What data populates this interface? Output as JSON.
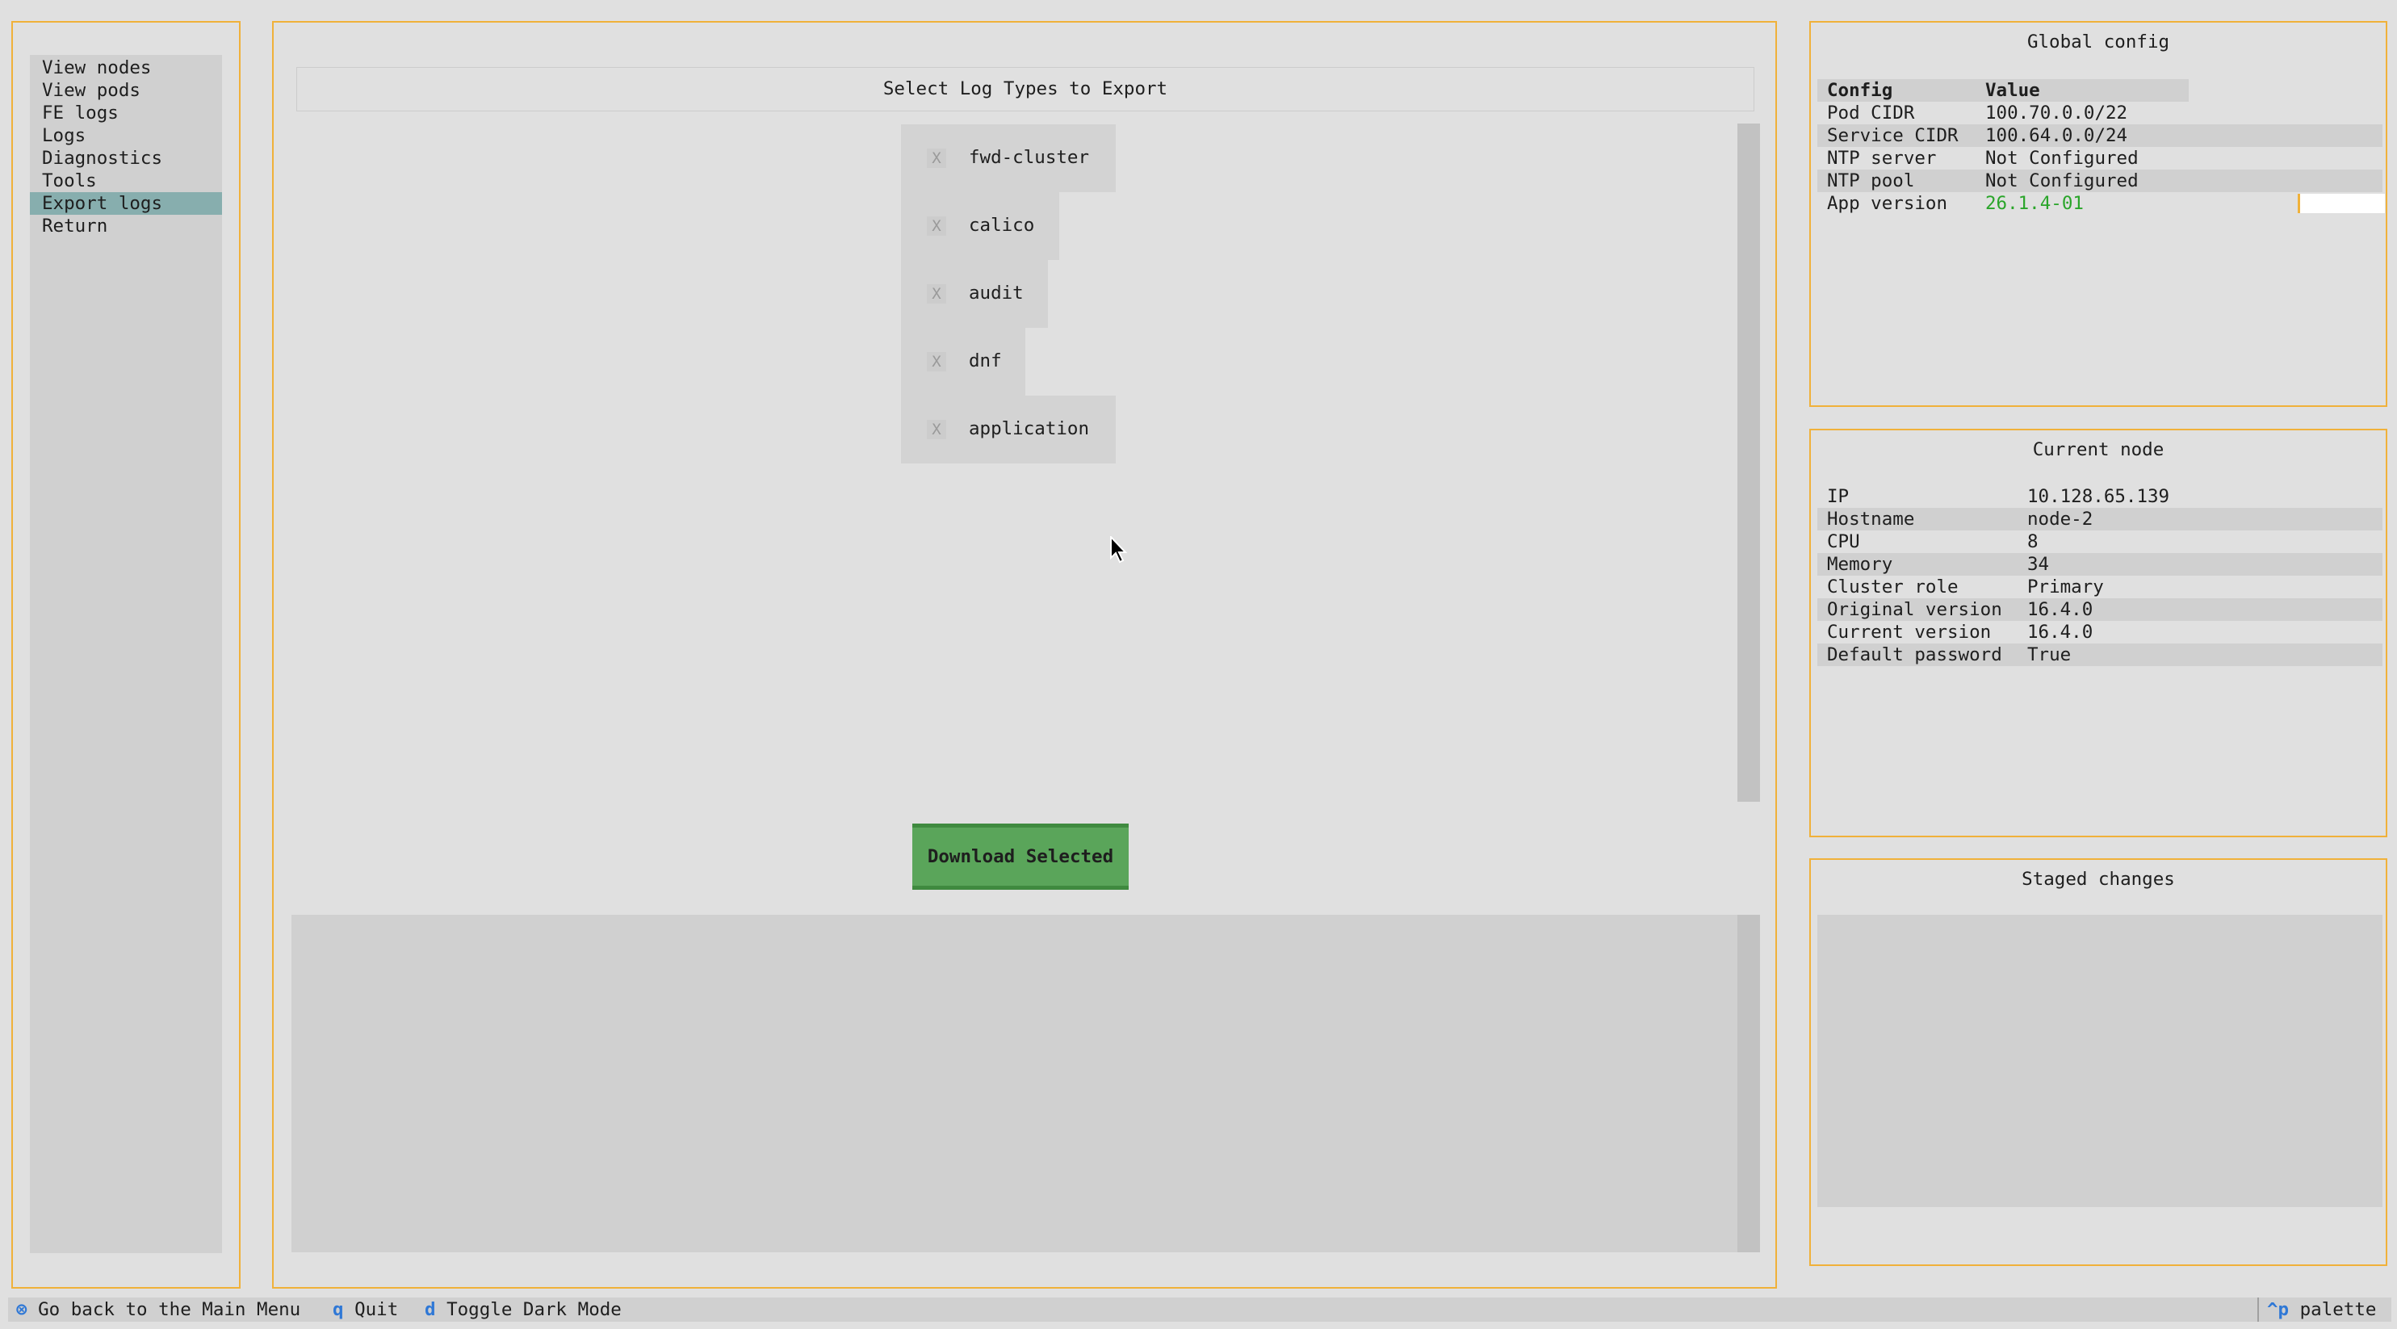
{
  "sidebar": {
    "items": [
      {
        "label": "View nodes"
      },
      {
        "label": "View pods"
      },
      {
        "label": "FE logs"
      },
      {
        "label": "Logs"
      },
      {
        "label": "Diagnostics"
      },
      {
        "label": "Tools"
      },
      {
        "label": "Export logs",
        "selected": true
      },
      {
        "label": "Return"
      }
    ]
  },
  "main": {
    "title": "Select Log Types to Export",
    "log_types": [
      {
        "mark": "X",
        "label": "fwd-cluster"
      },
      {
        "mark": "X",
        "label": "calico"
      },
      {
        "mark": "X",
        "label": "audit"
      },
      {
        "mark": "X",
        "label": "dnf"
      },
      {
        "mark": "X",
        "label": "application"
      }
    ],
    "download_button": "Download Selected"
  },
  "global_config": {
    "title": "Global config",
    "header": {
      "config": "Config",
      "value": "Value"
    },
    "rows": [
      {
        "key": "Pod CIDR",
        "value": "100.70.0.0/22"
      },
      {
        "key": "Service CIDR",
        "value": "100.64.0.0/24"
      },
      {
        "key": "NTP server",
        "value": "Not Configured"
      },
      {
        "key": "NTP pool",
        "value": "Not Configured"
      },
      {
        "key": "App version",
        "value": "26.1.4-01"
      }
    ],
    "value_color_app_version": "#2aa52a"
  },
  "current_node": {
    "title": "Current node",
    "rows": [
      {
        "key": "IP",
        "value": "10.128.65.139"
      },
      {
        "key": "Hostname",
        "value": "node-2"
      },
      {
        "key": "CPU",
        "value": "8"
      },
      {
        "key": "Memory",
        "value": "34"
      },
      {
        "key": "Cluster role",
        "value": "Primary"
      },
      {
        "key": "Original version",
        "value": "16.4.0"
      },
      {
        "key": "Current version",
        "value": "16.4.0"
      },
      {
        "key": "Default password",
        "value": "True"
      }
    ]
  },
  "staged_changes": {
    "title": "Staged changes"
  },
  "footer": {
    "back_key": "⊗",
    "back_label": "Go back to the Main Menu",
    "quit_key": "q",
    "quit_label": "Quit",
    "dark_key": "d",
    "dark_label": "Toggle Dark Mode",
    "palette_key": "^p",
    "palette_label": "palette"
  },
  "colors": {
    "border": "#f0b13a",
    "selected_item": "#87aeae",
    "button": "#5aa55a",
    "footer_key": "#2f78d6"
  }
}
